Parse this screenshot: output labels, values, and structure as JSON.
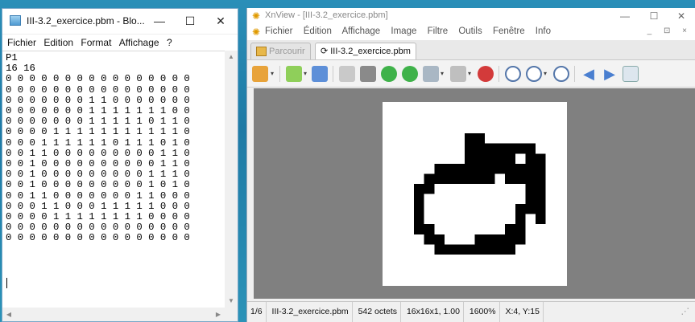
{
  "notepad": {
    "title": "III-3.2_exercice.pbm - Blo...",
    "controls": {
      "minimize": "—",
      "maximize": "☐",
      "close": "✕"
    },
    "menu": [
      "Fichier",
      "Edition",
      "Format",
      "Affichage",
      "?"
    ],
    "content": "P1\n16 16\n0 0 0 0 0 0 0 0 0 0 0 0 0 0 0 0\n0 0 0 0 0 0 0 0 0 0 0 0 0 0 0 0\n0 0 0 0 0 0 0 1 1 0 0 0 0 0 0 0\n0 0 0 0 0 0 0 1 1 1 1 1 1 1 0 0\n0 0 0 0 0 0 0 1 1 1 1 1 0 1 1 0\n0 0 0 0 1 1 1 1 1 1 1 1 1 1 1 0\n0 0 0 1 1 1 1 1 1 0 1 1 1 0 1 0\n0 0 1 1 0 0 0 0 0 0 0 0 0 1 1 0\n0 0 1 0 0 0 0 0 0 0 0 0 0 1 1 0\n0 0 1 0 0 0 0 0 0 0 0 0 1 1 1 0\n0 0 1 0 0 0 0 0 0 0 0 0 1 0 1 0\n0 0 1 1 0 0 0 0 0 0 0 1 1 0 0 0\n0 0 0 1 1 0 0 0 1 1 1 1 1 0 0 0\n0 0 0 0 1 1 1 1 1 1 1 1 0 0 0 0\n0 0 0 0 0 0 0 0 0 0 0 0 0 0 0 0\n0 0 0 0 0 0 0 0 0 0 0 0 0 0 0 0"
  },
  "xnview": {
    "title": "XnView - [III-3.2_exercice.pbm]",
    "controls": {
      "minimize": "—",
      "maximize": "☐",
      "close": "✕"
    },
    "menu": [
      "Fichier",
      "Édition",
      "Affichage",
      "Image",
      "Filtre",
      "Outils",
      "Fenêtre",
      "Info"
    ],
    "mdi_controls": "_ ⊡ ×",
    "tabs": [
      {
        "label": "Parcourir",
        "active": false
      },
      {
        "label": "III-3.2_exercice.pbm",
        "active": true
      }
    ],
    "toolbar_icons": [
      "browser-icon",
      "open-folder-icon",
      "save-icon",
      "undo-icon",
      "crop-icon",
      "rotate-left-icon",
      "rotate-right-icon",
      "adjust-icon",
      "print-icon",
      "effects-icon",
      "zoom-in-icon",
      "zoom-original-icon",
      "zoom-out-icon",
      "previous-icon",
      "next-icon",
      "fullscreen-icon"
    ],
    "status": [
      "1/6",
      "III-3.2_exercice.pbm",
      "542 octets",
      "16x16x1, 1.00",
      "1600%",
      "X:4, Y:15"
    ],
    "pixels": [
      "0000000000000000",
      "0000000000000000",
      "0000000110000000",
      "0000000111111100",
      "0000000111110110",
      "0000111111111110",
      "0001111111011110",
      "0011000000000110",
      "0010000000000110",
      "0010000000001110",
      "0010000000001010",
      "0011000000011000",
      "0001100011111000",
      "0000111111110000",
      "0000000000000000",
      "0000000000000000"
    ]
  }
}
